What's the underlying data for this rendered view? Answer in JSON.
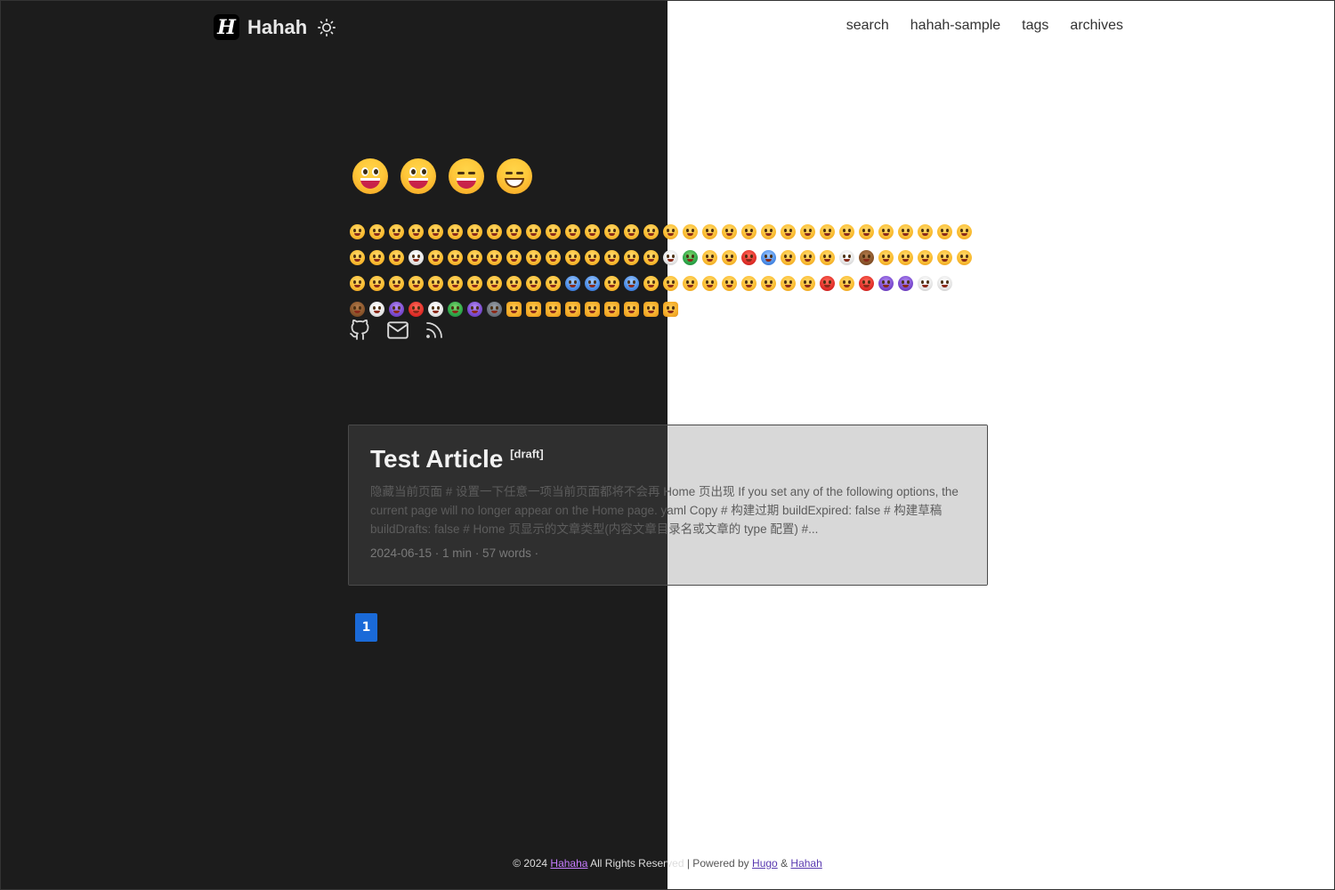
{
  "site": {
    "logo_letter": "H",
    "title": "Hahah"
  },
  "nav": {
    "items": [
      "search",
      "hahah-sample",
      "tags",
      "archives"
    ]
  },
  "emoji_row_count": 4,
  "socials": [
    "github-icon",
    "mail-icon",
    "rss-icon"
  ],
  "post": {
    "title": "Test Article",
    "badge": "[draft]",
    "summary": "隐藏当前页面 # 设置一下任意一项当前页面都将不会再 Home 页出现 If you set any of the following options, the current page will no longer appear on the Home page. yaml Copy # 构建过期 buildExpired: false # 构建草稿 buildDrafts: false # Home 页显示的文章类型(内容文章目录名或文章的 type 配置) #...",
    "meta": "2024-06-15 · 1 min · 57 words ·"
  },
  "pagination": {
    "current": "1"
  },
  "footer": {
    "copyright": "© 2024",
    "site_link": "Hahaha",
    "rights": "All Rights Reserved",
    "powered_prefix": " | Powered by",
    "hugo": "Hugo",
    "amp": "&",
    "theme": "Hahah"
  },
  "colors": {
    "dark_bg": "#1c1c1c",
    "light_bg": "#ffffff",
    "accent": "#1a6ad8"
  }
}
